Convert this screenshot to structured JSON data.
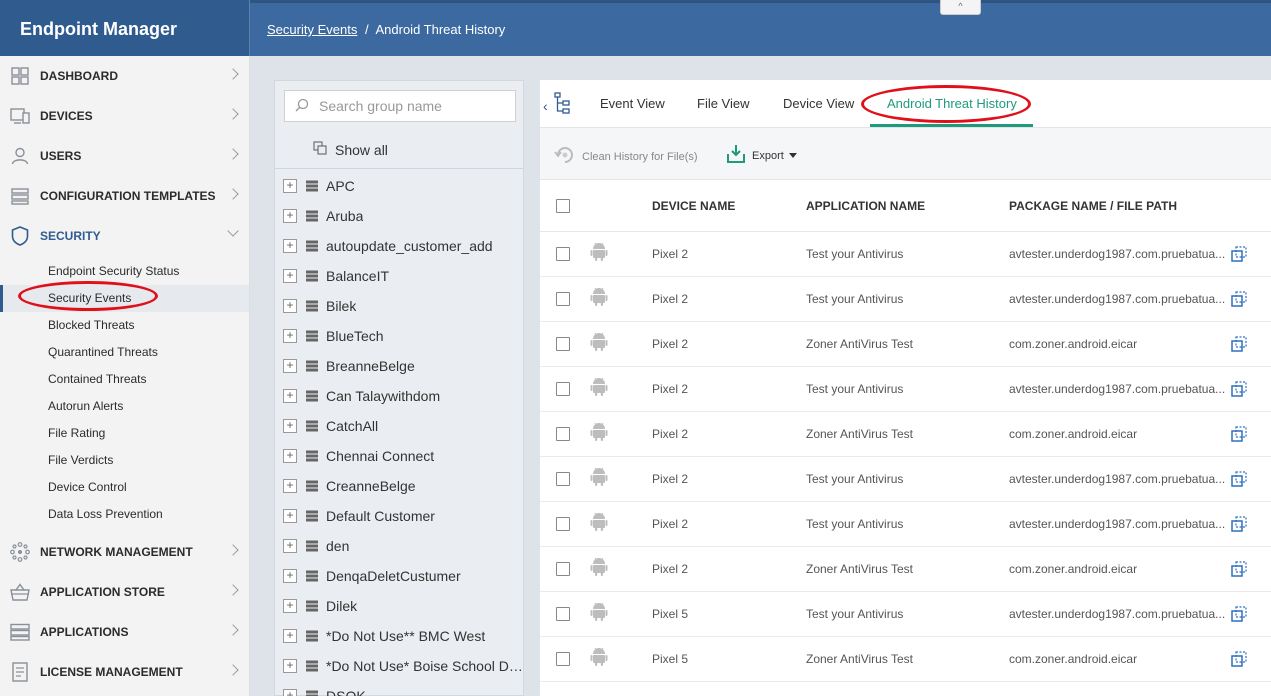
{
  "header": {
    "brand": "Endpoint Manager",
    "breadcrumb_parent": "Security Events",
    "breadcrumb_separator": "/",
    "breadcrumb_current": "Android Threat History",
    "collapse_glyph": "^"
  },
  "sidebar": {
    "items": [
      {
        "label": "DASHBOARD",
        "icon": "dashboard-grid-icon"
      },
      {
        "label": "DEVICES",
        "icon": "devices-icon"
      },
      {
        "label": "USERS",
        "icon": "user-icon"
      },
      {
        "label": "CONFIGURATION TEMPLATES",
        "icon": "templates-icon"
      },
      {
        "label": "SECURITY",
        "icon": "shield-icon"
      },
      {
        "label": "NETWORK MANAGEMENT",
        "icon": "network-icon"
      },
      {
        "label": "APPLICATION STORE",
        "icon": "store-basket-icon"
      },
      {
        "label": "APPLICATIONS",
        "icon": "applications-icon"
      },
      {
        "label": "LICENSE MANAGEMENT",
        "icon": "license-icon"
      }
    ],
    "security_sub": [
      "Endpoint Security Status",
      "Security Events",
      "Blocked Threats",
      "Quarantined Threats",
      "Contained Threats",
      "Autorun Alerts",
      "File Rating",
      "File Verdicts",
      "Device Control",
      "Data Loss Prevention"
    ]
  },
  "groups": {
    "search_placeholder": "Search group name",
    "show_all": "Show all",
    "items": [
      "APC",
      "Aruba",
      "autoupdate_customer_add",
      "BalanceIT",
      "Bilek",
      "BlueTech",
      "BreanneBelge",
      "Can Talaywithdom",
      "CatchAll",
      "Chennai Connect",
      "CreanneBelge",
      "Default Customer",
      "den",
      "DenqaDeletCustumer",
      "Dilek",
      "*Do Not Use** BMC West",
      "*Do Not Use* Boise School Di...",
      "DSOK"
    ]
  },
  "tabs": [
    "Event View",
    "File View",
    "Device View",
    "Android Threat History"
  ],
  "toolbar": {
    "clean_history": "Clean History for File(s)",
    "export": "Export"
  },
  "table": {
    "columns": [
      "DEVICE NAME",
      "APPLICATION NAME",
      "PACKAGE NAME / FILE PATH"
    ],
    "rows": [
      {
        "device": "Pixel 2",
        "app": "Test your Antivirus",
        "path": "avtester.underdog1987.com.pruebatua..."
      },
      {
        "device": "Pixel 2",
        "app": "Test your Antivirus",
        "path": "avtester.underdog1987.com.pruebatua..."
      },
      {
        "device": "Pixel 2",
        "app": "Zoner AntiVirus Test",
        "path": "com.zoner.android.eicar"
      },
      {
        "device": "Pixel 2",
        "app": "Test your Antivirus",
        "path": "avtester.underdog1987.com.pruebatua..."
      },
      {
        "device": "Pixel 2",
        "app": "Zoner AntiVirus Test",
        "path": "com.zoner.android.eicar"
      },
      {
        "device": "Pixel 2",
        "app": "Test your Antivirus",
        "path": "avtester.underdog1987.com.pruebatua..."
      },
      {
        "device": "Pixel 2",
        "app": "Test your Antivirus",
        "path": "avtester.underdog1987.com.pruebatua..."
      },
      {
        "device": "Pixel 2",
        "app": "Zoner AntiVirus Test",
        "path": "com.zoner.android.eicar"
      },
      {
        "device": "Pixel 5",
        "app": "Test your Antivirus",
        "path": "avtester.underdog1987.com.pruebatua..."
      },
      {
        "device": "Pixel 5",
        "app": "Zoner AntiVirus Test",
        "path": "com.zoner.android.eicar"
      }
    ]
  },
  "colors": {
    "brand_blue": "#2f5b8f",
    "active_tab": "#1f9a7a",
    "annotation_red": "#e0101a"
  }
}
